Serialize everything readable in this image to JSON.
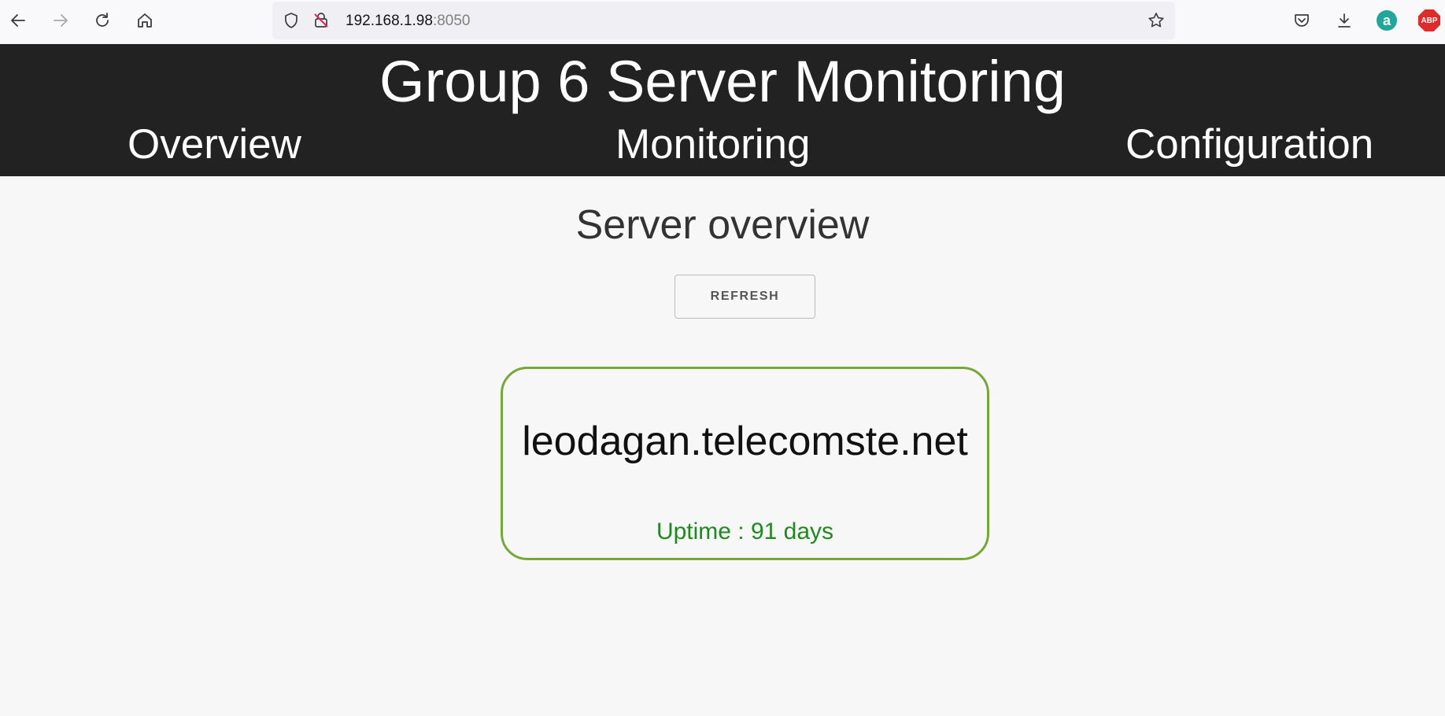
{
  "browser": {
    "url_host": "192.168.1.98",
    "url_port": ":8050",
    "extensions": {
      "amazon_label": "a",
      "adblock_label": "ABP"
    }
  },
  "header": {
    "title": "Group 6 Server Monitoring",
    "nav": [
      {
        "label": "Overview"
      },
      {
        "label": "Monitoring"
      },
      {
        "label": "Configuration"
      }
    ]
  },
  "main": {
    "heading": "Server overview",
    "refresh_label": "REFRESH",
    "server": {
      "hostname": "leodagan.telecomste.net",
      "uptime": "Uptime : 91 days",
      "status_color": "#75a935"
    }
  },
  "colors": {
    "header_bg": "#222222",
    "page_bg": "#f7f7f7",
    "uptime_text": "#1e8a1e"
  }
}
